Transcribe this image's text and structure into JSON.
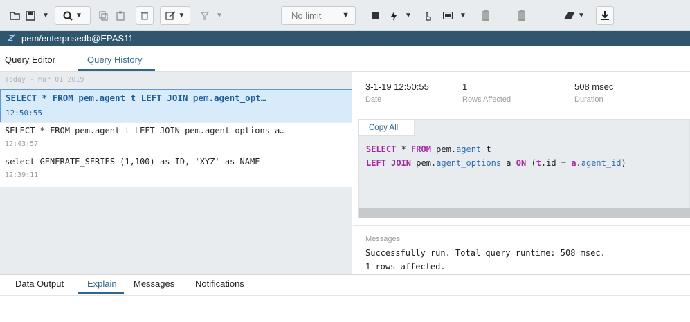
{
  "toolbar": {
    "limit_select": {
      "selected": "No limit"
    },
    "icons": [
      "open-file-icon",
      "save-icon",
      "find-icon",
      "copy-icon",
      "paste-icon",
      "delete-icon",
      "edit-icon",
      "filter-icon",
      "stop-icon",
      "execute-icon",
      "explain-icon",
      "commit-icon",
      "rollback-icon",
      "clear-icon",
      "download-icon"
    ]
  },
  "connection": {
    "title": "pem/enterprisedb@EPAS11"
  },
  "editor_tabs": [
    {
      "label": "Query Editor"
    },
    {
      "label": "Query History",
      "active": true
    }
  ],
  "history": {
    "date_header": "Today - Mar 01 2019",
    "items": [
      {
        "query": "SELECT * FROM pem.agent t LEFT JOIN pem.agent_opt…",
        "time": "12:50:55",
        "selected": true
      },
      {
        "query": "SELECT * FROM pem.agent t LEFT JOIN pem.agent_options a…",
        "time": "12:43:57"
      },
      {
        "query": "select GENERATE_SERIES (1,100) as ID, 'XYZ' as NAME",
        "time": "12:39:11"
      }
    ]
  },
  "details": {
    "date": {
      "value": "3-1-19 12:50:55",
      "label": "Date"
    },
    "rows": {
      "value": "1",
      "label": "Rows Affected"
    },
    "duration": {
      "value": "508 msec",
      "label": "Duration"
    },
    "copy_all": "Copy All",
    "code": {
      "l1": {
        "k1": "SELECT",
        "p1": " * ",
        "k2": "FROM",
        "p2": " pem.",
        "i1": "agent",
        "p3": " t"
      },
      "l2": {
        "k1": "LEFT JOIN",
        "p1": " pem.",
        "i1": "agent_options",
        "p2": " a ",
        "k2": "ON",
        "p3": " (",
        "k3": "t",
        "p4": ".id = ",
        "k4": "a",
        "p5": ".",
        "i2": "agent_id",
        "p6": ")"
      }
    },
    "messages_label": "Messages",
    "message_lines": [
      "Successfully run. Total query runtime: 508 msec.",
      "1 rows affected."
    ]
  },
  "bottom_tabs": [
    {
      "label": "Data Output"
    },
    {
      "label": "Explain",
      "active": true
    },
    {
      "label": "Messages"
    },
    {
      "label": "Notifications"
    }
  ],
  "colors": {
    "accent": "#326690",
    "titlebar": "#30566d",
    "keyword": "#a626a4",
    "identifier": "#2f6eb0",
    "selection": "#d8ebfb"
  }
}
